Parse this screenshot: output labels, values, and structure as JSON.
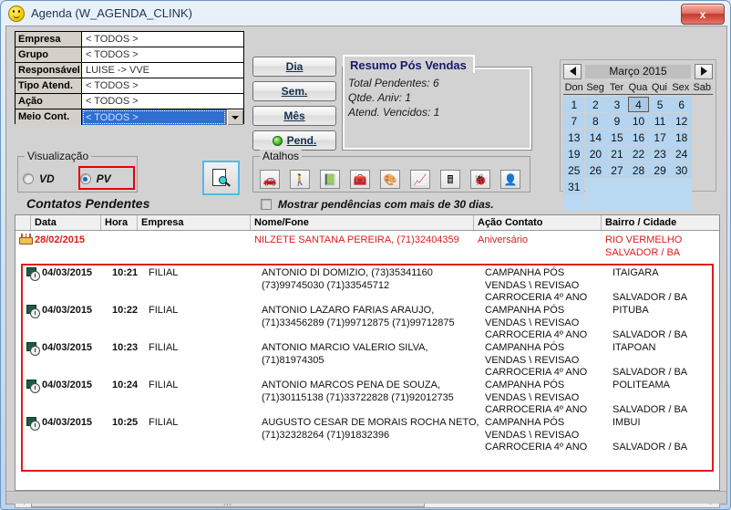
{
  "window": {
    "title": "Agenda (W_AGENDA_CLINK)",
    "icon": "smiley-icon",
    "close_label": "x"
  },
  "filters": {
    "rows": [
      {
        "label": "Empresa",
        "value": "< TODOS >",
        "selected": false
      },
      {
        "label": "Grupo",
        "value": "< TODOS >",
        "selected": false
      },
      {
        "label": "Responsável",
        "value": "LUISE       -> VVE",
        "selected": false
      },
      {
        "label": "Tipo Atend.",
        "value": "< TODOS >",
        "selected": false
      },
      {
        "label": "Ação",
        "value": "< TODOS >",
        "selected": false
      },
      {
        "label": "Meio Cont.",
        "value": "< TODOS >",
        "selected": true
      }
    ]
  },
  "period_buttons": [
    {
      "label": "Dia",
      "accel": "D",
      "dot": false
    },
    {
      "label": "Sem.",
      "accel": "S",
      "dot": false
    },
    {
      "label": "Mês",
      "accel": "M",
      "dot": false
    },
    {
      "label": "Pend.",
      "accel": "P",
      "dot": true
    }
  ],
  "resumo": {
    "caption": "Resumo Pós Vendas",
    "line1": "Total Pendentes: 6",
    "line2": "Qtde. Aniv: 1",
    "line3": "Atend. Vencidos: 1"
  },
  "calendar": {
    "title": "Março 2015",
    "prev": "◀",
    "next": "▶",
    "dow": [
      "Don",
      "Seg",
      "Ter",
      "Qua",
      "Qui",
      "Sex",
      "Sab"
    ],
    "selected_day": 4,
    "days": [
      1,
      2,
      3,
      4,
      5,
      6,
      7,
      8,
      9,
      10,
      11,
      12,
      13,
      14,
      15,
      16,
      17,
      18,
      19,
      20,
      21,
      22,
      23,
      24,
      25,
      26,
      27,
      28,
      29,
      30,
      31
    ]
  },
  "visualizacao": {
    "caption": "Visualização",
    "options": [
      {
        "label": "VD",
        "checked": false
      },
      {
        "label": "PV",
        "checked": true
      }
    ],
    "highlight_color": "#e60000"
  },
  "contatos_title": "Contatos Pendentes",
  "search_button": {
    "icon": "document-search-icon"
  },
  "atalhos": {
    "caption": "Atalhos",
    "icons": [
      "car-icon",
      "person-walking-icon",
      "green-box-icon",
      "toolbox-icon",
      "dark-disc-icon",
      "chart-pencil-icon",
      "calculator-icon",
      "bug-icon",
      "yellow-person-icon"
    ],
    "glyphs": [
      "🚗",
      "🚶",
      "📗",
      "🧰",
      "🎨",
      "📈",
      "🖩",
      "🐞",
      "👤"
    ]
  },
  "checkbox_30dias": {
    "label": "Mostrar pendências com mais de 30 dias.",
    "checked": false
  },
  "list": {
    "columns": [
      "",
      "Data",
      "Hora",
      "Empresa",
      "Nome/Fone",
      "Ação Contato",
      "Bairro / Cidade"
    ],
    "aniversario_row": {
      "icon": "birthday-cake-icon",
      "data": "28/02/2015",
      "hora": "",
      "empresa": "",
      "nome": "NILZETE SANTANA PEREIRA, (71)32404359",
      "nome2": "",
      "acao": "Aniversário",
      "bairro": "RIO VERMELHO",
      "cidade": "SALVADOR / BA"
    },
    "pending_rows": [
      {
        "icon": "clock-icon",
        "data": "04/03/2015",
        "hora": "10:21",
        "empresa": "FILIAL",
        "nome": "ANTONIO DI DOMIZIO, (73)35341160",
        "nome2": "(73)99745030 (71)33545712",
        "acao": "CAMPANHA PÓS VENDAS \\ REVISAO CARROCERIA 4º ANO",
        "bairro": "ITAIGARA",
        "cidade": "SALVADOR / BA"
      },
      {
        "icon": "clock-icon",
        "data": "04/03/2015",
        "hora": "10:22",
        "empresa": "FILIAL",
        "nome": "ANTONIO LAZARO FARIAS ARAUJO,",
        "nome2": "(71)33456289 (71)99712875 (71)99712875",
        "acao": "CAMPANHA PÓS VENDAS \\ REVISAO CARROCERIA 4º ANO",
        "bairro": "PITUBA",
        "cidade": "SALVADOR / BA"
      },
      {
        "icon": "clock-icon",
        "data": "04/03/2015",
        "hora": "10:23",
        "empresa": "FILIAL",
        "nome": "ANTONIO MARCIO VALERIO SILVA,",
        "nome2": "(71)81974305",
        "acao": "CAMPANHA PÓS VENDAS \\ REVISAO CARROCERIA 4º ANO",
        "bairro": "ITAPOAN",
        "cidade": "SALVADOR / BA"
      },
      {
        "icon": "clock-icon",
        "data": "04/03/2015",
        "hora": "10:24",
        "empresa": "FILIAL",
        "nome": "ANTONIO MARCOS PENA DE SOUZA,",
        "nome2": "(71)30115138 (71)33722828 (71)92012735",
        "acao": "CAMPANHA PÓS VENDAS \\ REVISAO CARROCERIA 4º ANO",
        "bairro": "POLITEAMA",
        "cidade": "SALVADOR / BA"
      },
      {
        "icon": "clock-icon",
        "data": "04/03/2015",
        "hora": "10:25",
        "empresa": "FILIAL",
        "nome": "AUGUSTO CESAR DE MORAIS ROCHA NETO,",
        "nome2": "(71)32328264 (71)91832396",
        "acao": "CAMPANHA PÓS VENDAS \\ REVISAO CARROCERIA 4º ANO",
        "bairro": "IMBUI",
        "cidade": "SALVADOR / BA"
      }
    ]
  },
  "scrollbar": {
    "thumb_glyph": "|||"
  }
}
